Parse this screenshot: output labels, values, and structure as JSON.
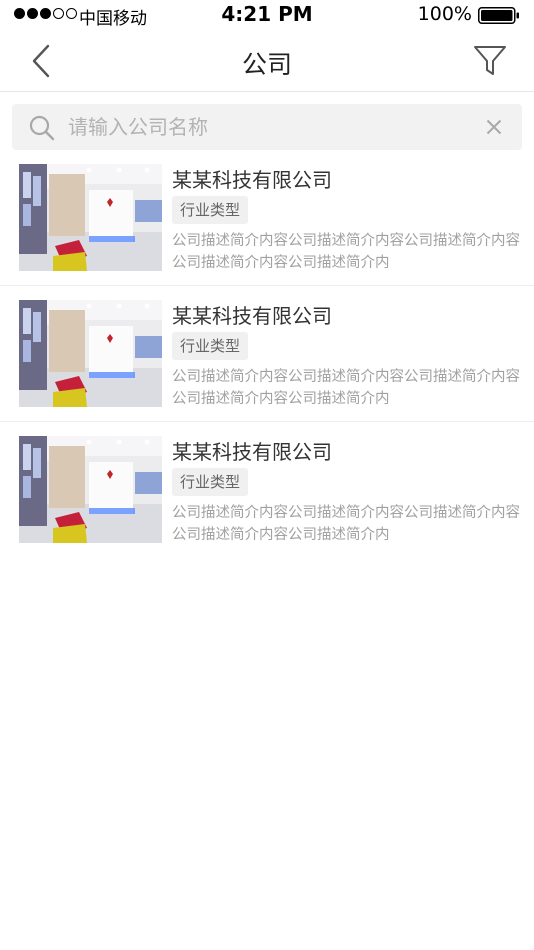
{
  "status_bar": {
    "carrier": "中国移动",
    "time": "4:21 PM",
    "battery": "100%",
    "signal_bars": 3
  },
  "nav": {
    "title": "公司",
    "back_icon": "chevron-left-icon",
    "filter_icon": "filter-icon"
  },
  "search": {
    "placeholder": "请输入公司名称",
    "value": ""
  },
  "companies": [
    {
      "name": "某某科技有限公司",
      "tag": "行业类型",
      "description": "公司描述简介内容公司描述简介内容公司描述简介内容公司描述简介内容公司描述简介内"
    },
    {
      "name": "某某科技有限公司",
      "tag": "行业类型",
      "description": "公司描述简介内容公司描述简介内容公司描述简介内容公司描述简介内容公司描述简介内"
    },
    {
      "name": "某某科技有限公司",
      "tag": "行业类型",
      "description": "公司描述简介内容公司描述简介内容公司描述简介内容公司描述简介内容公司描述简介内"
    }
  ],
  "colors": {
    "divider": "#e6e6e6",
    "search_bg": "#f2f2f2",
    "tag_bg": "#f0f0f0",
    "desc_text": "#a0a0a0"
  }
}
